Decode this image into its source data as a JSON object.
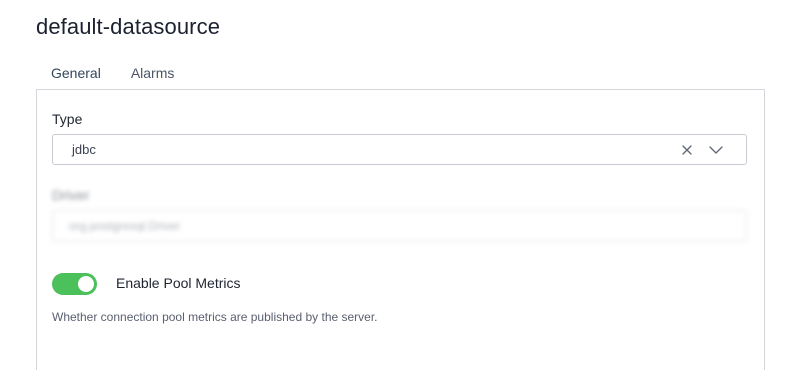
{
  "page": {
    "title": "default-datasource"
  },
  "tabs": [
    {
      "label": "General",
      "active": true
    },
    {
      "label": "Alarms",
      "active": false
    }
  ],
  "form": {
    "type_label": "Type",
    "type_value": "jdbc",
    "driver_label": "Driver",
    "driver_value": "org.postgresql.Driver",
    "pool_metrics": {
      "label": "Enable Pool Metrics",
      "enabled": true,
      "help": "Whether connection pool metrics are published by the server."
    }
  },
  "colors": {
    "toggle_on": "#4cc05a",
    "tab_active_underline": "#2f4a63"
  },
  "icons": {
    "clear": "close-icon",
    "dropdown": "chevron-down-icon"
  }
}
